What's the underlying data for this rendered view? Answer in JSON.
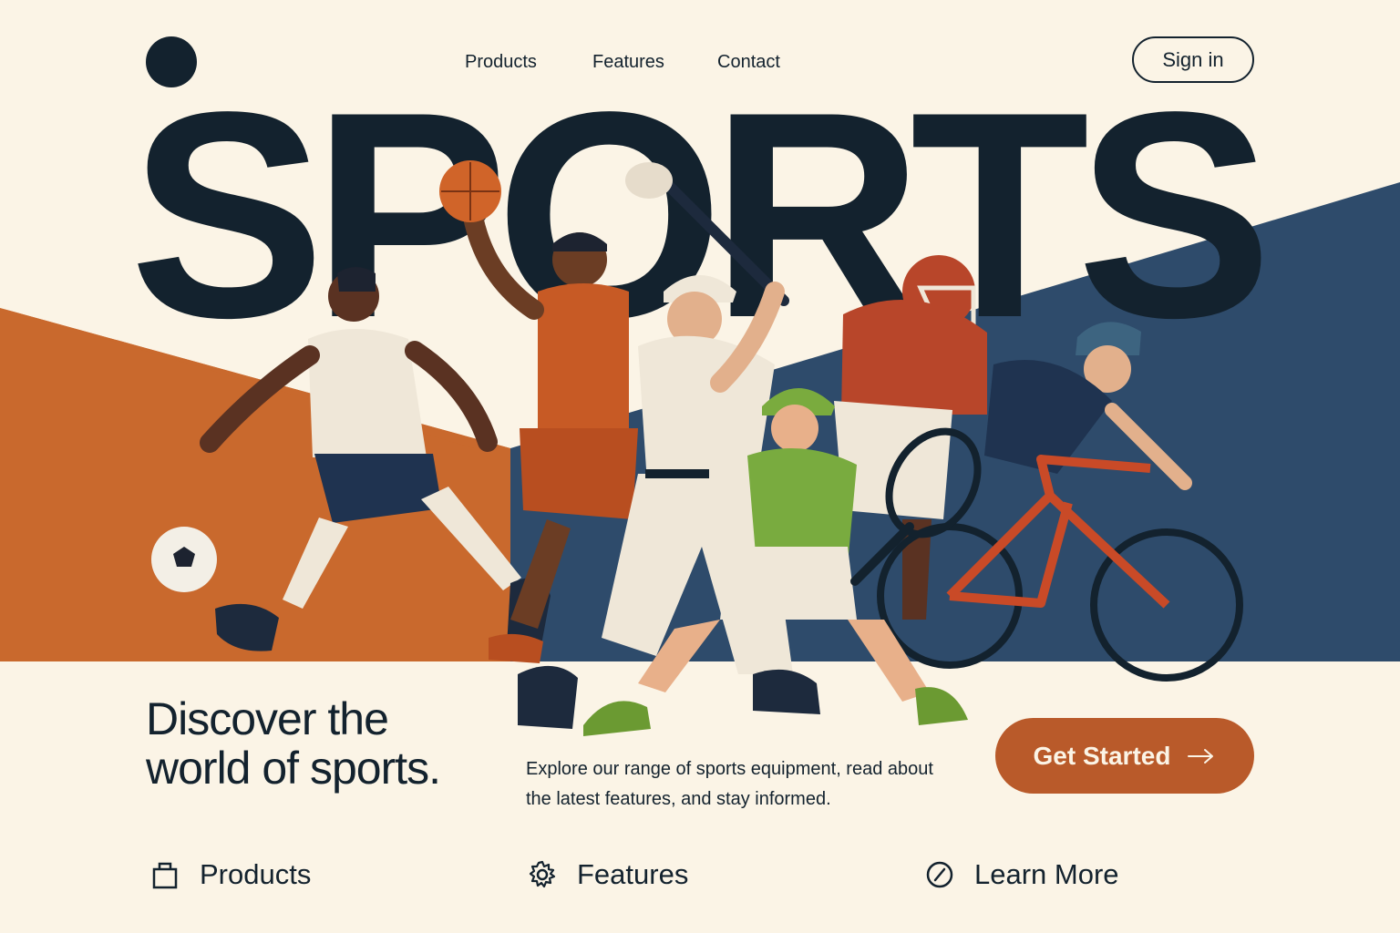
{
  "colors": {
    "background": "#fbf4e6",
    "ink": "#13222e",
    "orange_band": "#c9692d",
    "navy_band": "#2e4b6b",
    "cta": "#b95a2a"
  },
  "header": {
    "logo_icon": "filled-circle-logo",
    "nav": [
      "Products",
      "Features",
      "Contact"
    ],
    "sign_in_label": "Sign in"
  },
  "hero": {
    "word": "SPORTS",
    "illustration": "athletes: soccer player, basketball player, baseball batter, tennis player, football player, cyclist"
  },
  "content": {
    "headline_line1": "Discover the",
    "headline_line2": "world of sports.",
    "description": "Explore our range of sports equipment, read about the latest features, and stay informed.",
    "cta_label": "Get Started",
    "cta_icon": "arrow-right-icon"
  },
  "bottom_links": [
    {
      "label": "Products",
      "icon": "bag-icon"
    },
    {
      "label": "Features",
      "icon": "gear-icon"
    },
    {
      "label": "Learn More",
      "icon": "compass-icon"
    }
  ]
}
